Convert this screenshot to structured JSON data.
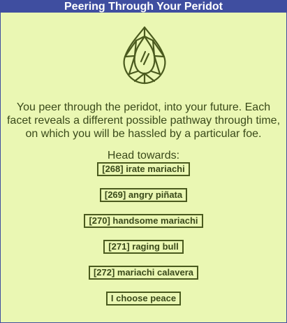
{
  "window": {
    "title": "Peering Through Your Peridot"
  },
  "gem_icon": "peridot-gem-icon",
  "description": {
    "line1": "You peer through the peridot, into your future. Each",
    "line2": "facet reveals a different possible pathway through time,",
    "line3": "on which you will be hassled by a particular foe."
  },
  "prompt": "Head towards:",
  "choices": [
    {
      "label": "[268] irate mariachi"
    },
    {
      "label": "[269] angry piñata"
    },
    {
      "label": "[270] handsome mariachi"
    },
    {
      "label": "[271] raging bull"
    },
    {
      "label": "[272] mariachi calavera"
    },
    {
      "label": "I choose peace"
    }
  ],
  "colors": {
    "titlebar": "#3f4ea0",
    "background": "#eaf7b3",
    "text": "#3a4a1a",
    "gem_outline": "#4a5a1e"
  }
}
